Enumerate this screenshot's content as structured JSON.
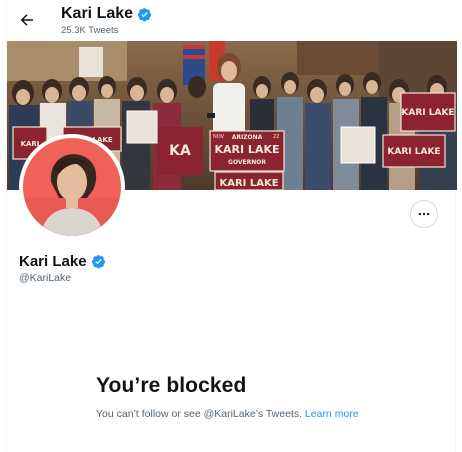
{
  "header": {
    "back_icon": "arrow-left-icon",
    "name": "Kari Lake",
    "tweet_count": "25.3K Tweets",
    "verified_icon": "verified-badge-icon"
  },
  "banner": {
    "signs": [
      "NOV",
      "ARIZONA",
      "KARI LAKE",
      "GOVERNOR",
      "22"
    ]
  },
  "profile": {
    "name": "Kari Lake",
    "handle": "@KariLake",
    "more_icon": "more-options-icon"
  },
  "blocked": {
    "title": "You’re blocked",
    "message": "You can’t follow or see @KariLake’s Tweets.",
    "link": "Learn more"
  },
  "colors": {
    "accent": "#1d9bf0",
    "text": "#0f1419",
    "secondary": "#536471",
    "sign_red": "#8c2331"
  }
}
